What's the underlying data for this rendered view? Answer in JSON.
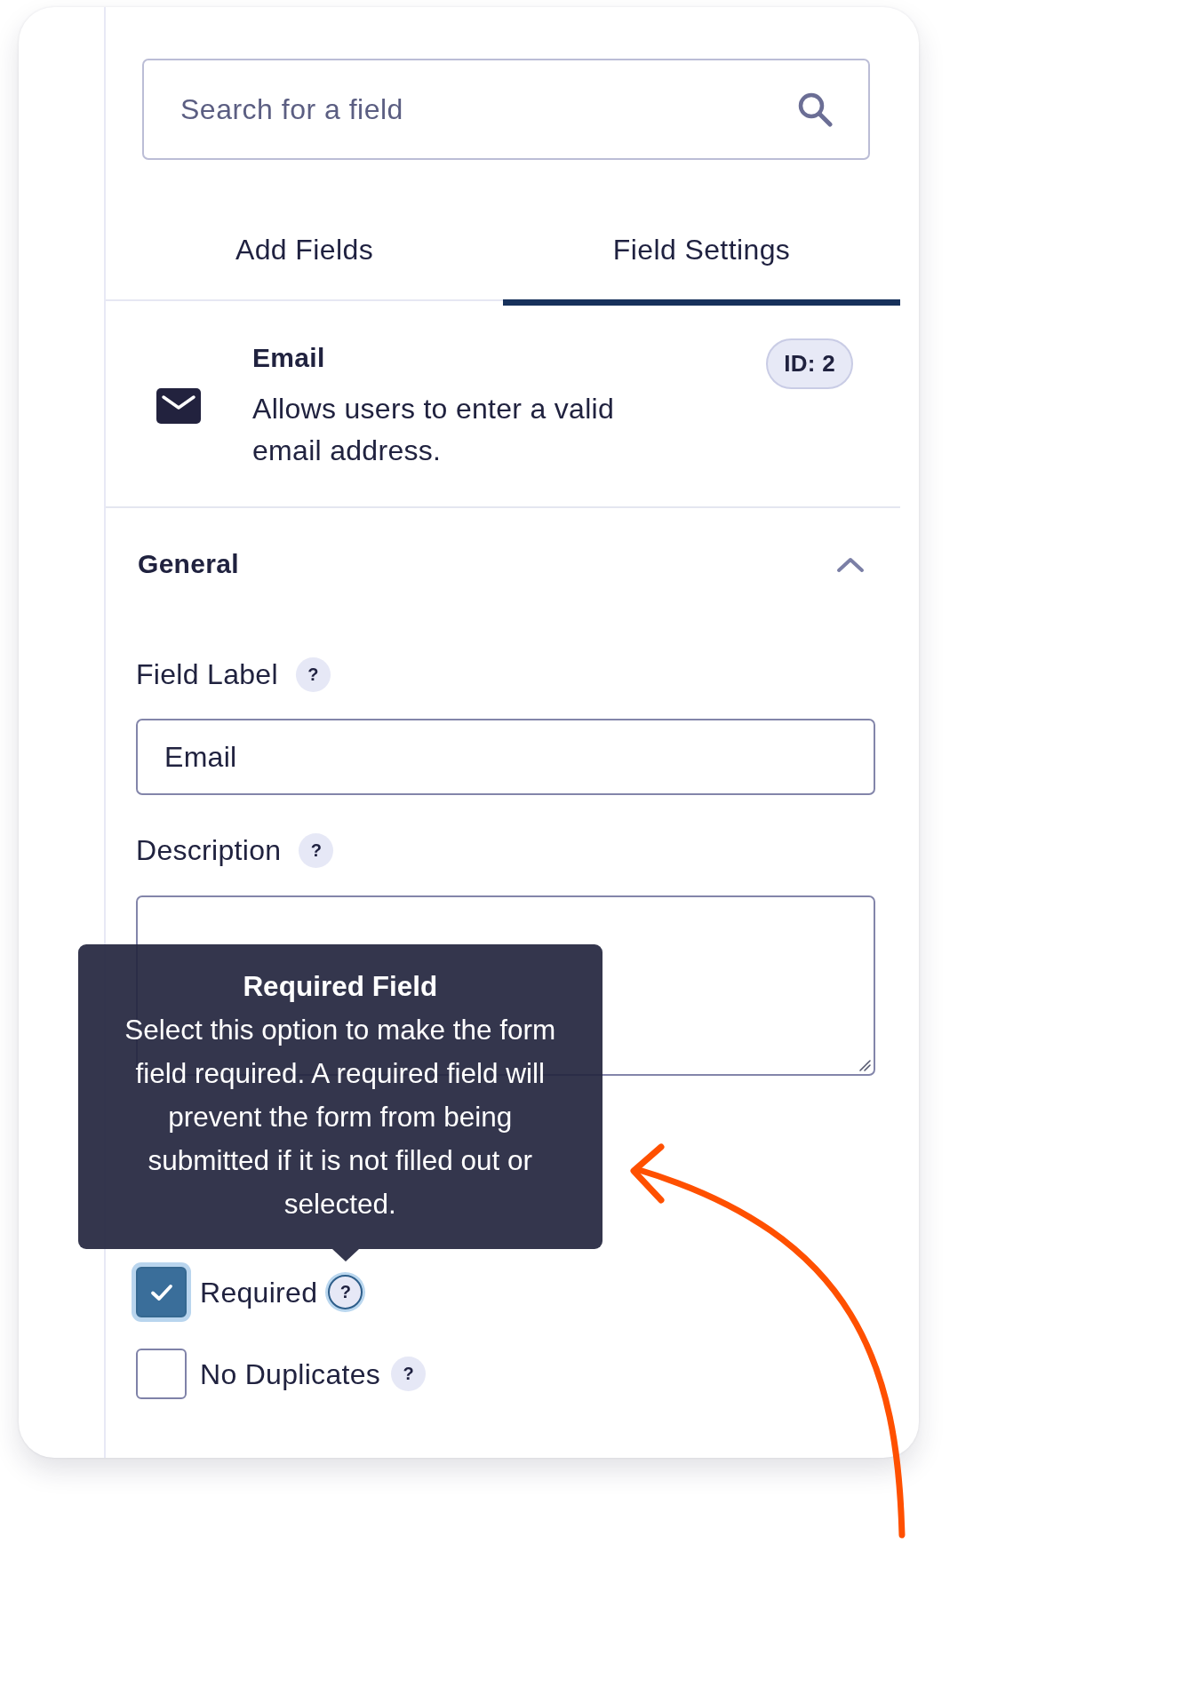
{
  "search": {
    "placeholder": "Search for a field"
  },
  "tabs": [
    {
      "label": "Add Fields",
      "selected": false
    },
    {
      "label": "Field Settings",
      "selected": true
    }
  ],
  "field_info": {
    "title": "Email",
    "description": "Allows users to enter a valid email address.",
    "id_badge": "ID: 2"
  },
  "section": {
    "title": "General",
    "expanded": true,
    "fields": [
      {
        "kind": "text",
        "label": "Field Label",
        "help": {
          "label": "?",
          "focused": false
        },
        "value": "Email"
      },
      {
        "kind": "textarea",
        "label": "Description",
        "help": {
          "label": "?",
          "focused": false
        }
      }
    ],
    "rules": [
      {
        "label": "Required",
        "checked": true,
        "help": {
          "label": "?",
          "focused": true
        }
      },
      {
        "label": "No Duplicates",
        "checked": false,
        "help": {
          "label": "?",
          "focused": false
        }
      }
    ]
  },
  "tooltip": {
    "title": "Required Field",
    "text": "Select this option to make the form field required. A required field will prevent the form from being submitted if it is not filled out or selected."
  }
}
